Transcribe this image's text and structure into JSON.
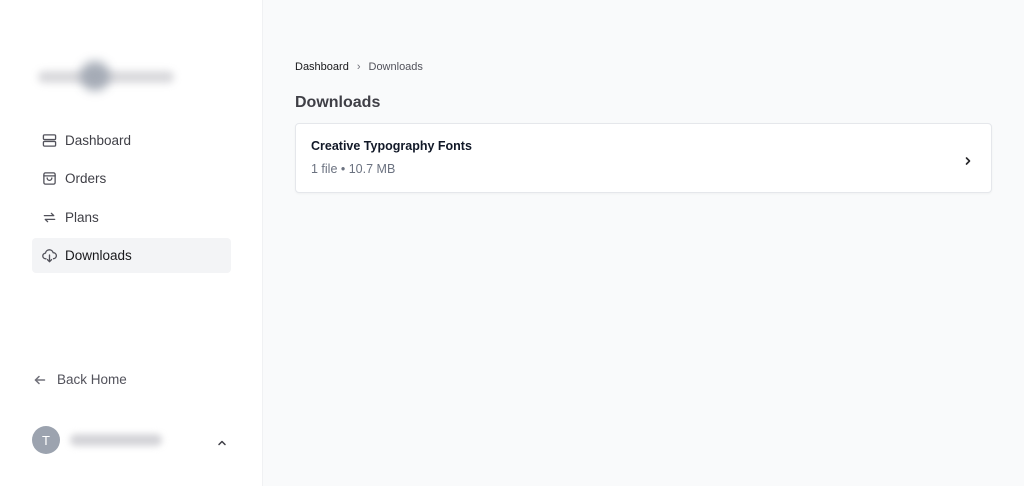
{
  "sidebar": {
    "logo_icon": "brand-logo-blurred",
    "items": [
      {
        "label": "Dashboard",
        "icon": "server-icon",
        "active": false
      },
      {
        "label": "Orders",
        "icon": "shopping-bag-icon",
        "active": false
      },
      {
        "label": "Plans",
        "icon": "repeat-icon",
        "active": false
      },
      {
        "label": "Downloads",
        "icon": "cloud-download-icon",
        "active": true
      }
    ],
    "back_home": {
      "label": "Back Home",
      "icon": "arrow-left-icon"
    },
    "user": {
      "initial": "T",
      "name_blurred": true,
      "icon": "chevron-up-icon"
    }
  },
  "breadcrumb": {
    "items": [
      "Dashboard",
      "Downloads"
    ],
    "separator": "›"
  },
  "main": {
    "title": "Downloads",
    "downloads": [
      {
        "title": "Creative Typography Fonts",
        "meta": "1 file • 10.7 MB",
        "icon": "chevron-right-icon"
      }
    ]
  },
  "colors": {
    "sidebar_bg": "#ffffff",
    "main_bg": "#f9fafb",
    "active_item_bg": "#f3f4f6",
    "avatar_bg": "#9ca3af"
  }
}
